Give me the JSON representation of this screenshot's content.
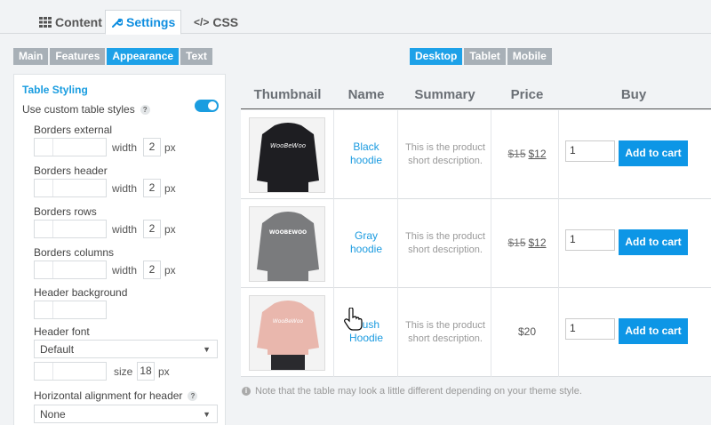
{
  "top_tabs": [
    {
      "label": "Content",
      "icon": "grid-icon"
    },
    {
      "label": "Settings",
      "icon": "wrench-icon"
    },
    {
      "label": "CSS",
      "icon": "code-icon"
    }
  ],
  "sub_tabs": [
    "Main",
    "Features",
    "Appearance",
    "Text"
  ],
  "device_tabs": [
    "Desktop",
    "Tablet",
    "Mobile"
  ],
  "panel": {
    "title": "Table Styling",
    "use_custom_label": "Use custom table styles",
    "help": "?",
    "borders_external": {
      "label": "Borders external",
      "width_label": "width",
      "width_value": "2",
      "unit": "px"
    },
    "borders_header": {
      "label": "Borders header",
      "width_label": "width",
      "width_value": "2",
      "unit": "px"
    },
    "borders_rows": {
      "label": "Borders rows",
      "width_label": "width",
      "width_value": "2",
      "unit": "px"
    },
    "borders_columns": {
      "label": "Borders columns",
      "width_label": "width",
      "width_value": "2",
      "unit": "px"
    },
    "header_background": {
      "label": "Header background"
    },
    "header_font": {
      "label": "Header font",
      "value": "Default",
      "size_label": "size",
      "size_value": "18",
      "unit": "px"
    },
    "h_align": {
      "label": "Horizontal alignment for header",
      "value": "None"
    }
  },
  "table": {
    "headers": [
      "Thumbnail",
      "Name",
      "Summary",
      "Price",
      "Buy"
    ],
    "rows": [
      {
        "name_line1": "Black",
        "name_line2": "hoodie",
        "desc_line1": "This is the product",
        "desc_line2": "short description.",
        "old_price": "$15",
        "price": "$12",
        "qty": "1",
        "cart": "Add to cart",
        "hoodie_color": "#1e1e22",
        "logo_text": "WooBeWoo"
      },
      {
        "name_line1": "Gray",
        "name_line2": "hoodie",
        "desc_line1": "This is the product",
        "desc_line2": "short description.",
        "old_price": "$15",
        "price": "$12",
        "qty": "1",
        "cart": "Add to cart",
        "hoodie_color": "#7a7b7d",
        "logo_text": "WOOBEWOO"
      },
      {
        "name_line1": "Blush",
        "name_line2": "Hoodie",
        "desc_line1": "This is the product",
        "desc_line2": "short description.",
        "old_price": "",
        "price": "$20",
        "qty": "1",
        "cart": "Add to cart",
        "hoodie_color": "#e9b7ad",
        "logo_text": "WooBeWoo"
      }
    ]
  },
  "note": "Note that the table may look a little different depending on your theme style.",
  "accent_color": "#1da1e8"
}
